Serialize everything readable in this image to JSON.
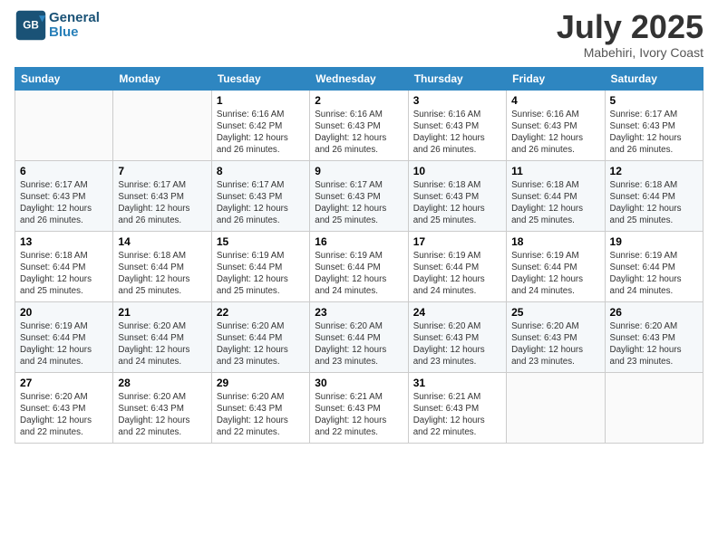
{
  "logo": {
    "line1": "General",
    "line2": "Blue"
  },
  "title": "July 2025",
  "location": "Mabehiri, Ivory Coast",
  "days_of_week": [
    "Sunday",
    "Monday",
    "Tuesday",
    "Wednesday",
    "Thursday",
    "Friday",
    "Saturday"
  ],
  "weeks": [
    [
      {
        "num": "",
        "detail": ""
      },
      {
        "num": "",
        "detail": ""
      },
      {
        "num": "1",
        "detail": "Sunrise: 6:16 AM\nSunset: 6:42 PM\nDaylight: 12 hours and 26 minutes."
      },
      {
        "num": "2",
        "detail": "Sunrise: 6:16 AM\nSunset: 6:43 PM\nDaylight: 12 hours and 26 minutes."
      },
      {
        "num": "3",
        "detail": "Sunrise: 6:16 AM\nSunset: 6:43 PM\nDaylight: 12 hours and 26 minutes."
      },
      {
        "num": "4",
        "detail": "Sunrise: 6:16 AM\nSunset: 6:43 PM\nDaylight: 12 hours and 26 minutes."
      },
      {
        "num": "5",
        "detail": "Sunrise: 6:17 AM\nSunset: 6:43 PM\nDaylight: 12 hours and 26 minutes."
      }
    ],
    [
      {
        "num": "6",
        "detail": "Sunrise: 6:17 AM\nSunset: 6:43 PM\nDaylight: 12 hours and 26 minutes."
      },
      {
        "num": "7",
        "detail": "Sunrise: 6:17 AM\nSunset: 6:43 PM\nDaylight: 12 hours and 26 minutes."
      },
      {
        "num": "8",
        "detail": "Sunrise: 6:17 AM\nSunset: 6:43 PM\nDaylight: 12 hours and 26 minutes."
      },
      {
        "num": "9",
        "detail": "Sunrise: 6:17 AM\nSunset: 6:43 PM\nDaylight: 12 hours and 25 minutes."
      },
      {
        "num": "10",
        "detail": "Sunrise: 6:18 AM\nSunset: 6:43 PM\nDaylight: 12 hours and 25 minutes."
      },
      {
        "num": "11",
        "detail": "Sunrise: 6:18 AM\nSunset: 6:44 PM\nDaylight: 12 hours and 25 minutes."
      },
      {
        "num": "12",
        "detail": "Sunrise: 6:18 AM\nSunset: 6:44 PM\nDaylight: 12 hours and 25 minutes."
      }
    ],
    [
      {
        "num": "13",
        "detail": "Sunrise: 6:18 AM\nSunset: 6:44 PM\nDaylight: 12 hours and 25 minutes."
      },
      {
        "num": "14",
        "detail": "Sunrise: 6:18 AM\nSunset: 6:44 PM\nDaylight: 12 hours and 25 minutes."
      },
      {
        "num": "15",
        "detail": "Sunrise: 6:19 AM\nSunset: 6:44 PM\nDaylight: 12 hours and 25 minutes."
      },
      {
        "num": "16",
        "detail": "Sunrise: 6:19 AM\nSunset: 6:44 PM\nDaylight: 12 hours and 24 minutes."
      },
      {
        "num": "17",
        "detail": "Sunrise: 6:19 AM\nSunset: 6:44 PM\nDaylight: 12 hours and 24 minutes."
      },
      {
        "num": "18",
        "detail": "Sunrise: 6:19 AM\nSunset: 6:44 PM\nDaylight: 12 hours and 24 minutes."
      },
      {
        "num": "19",
        "detail": "Sunrise: 6:19 AM\nSunset: 6:44 PM\nDaylight: 12 hours and 24 minutes."
      }
    ],
    [
      {
        "num": "20",
        "detail": "Sunrise: 6:19 AM\nSunset: 6:44 PM\nDaylight: 12 hours and 24 minutes."
      },
      {
        "num": "21",
        "detail": "Sunrise: 6:20 AM\nSunset: 6:44 PM\nDaylight: 12 hours and 24 minutes."
      },
      {
        "num": "22",
        "detail": "Sunrise: 6:20 AM\nSunset: 6:44 PM\nDaylight: 12 hours and 23 minutes."
      },
      {
        "num": "23",
        "detail": "Sunrise: 6:20 AM\nSunset: 6:44 PM\nDaylight: 12 hours and 23 minutes."
      },
      {
        "num": "24",
        "detail": "Sunrise: 6:20 AM\nSunset: 6:43 PM\nDaylight: 12 hours and 23 minutes."
      },
      {
        "num": "25",
        "detail": "Sunrise: 6:20 AM\nSunset: 6:43 PM\nDaylight: 12 hours and 23 minutes."
      },
      {
        "num": "26",
        "detail": "Sunrise: 6:20 AM\nSunset: 6:43 PM\nDaylight: 12 hours and 23 minutes."
      }
    ],
    [
      {
        "num": "27",
        "detail": "Sunrise: 6:20 AM\nSunset: 6:43 PM\nDaylight: 12 hours and 22 minutes."
      },
      {
        "num": "28",
        "detail": "Sunrise: 6:20 AM\nSunset: 6:43 PM\nDaylight: 12 hours and 22 minutes."
      },
      {
        "num": "29",
        "detail": "Sunrise: 6:20 AM\nSunset: 6:43 PM\nDaylight: 12 hours and 22 minutes."
      },
      {
        "num": "30",
        "detail": "Sunrise: 6:21 AM\nSunset: 6:43 PM\nDaylight: 12 hours and 22 minutes."
      },
      {
        "num": "31",
        "detail": "Sunrise: 6:21 AM\nSunset: 6:43 PM\nDaylight: 12 hours and 22 minutes."
      },
      {
        "num": "",
        "detail": ""
      },
      {
        "num": "",
        "detail": ""
      }
    ]
  ]
}
